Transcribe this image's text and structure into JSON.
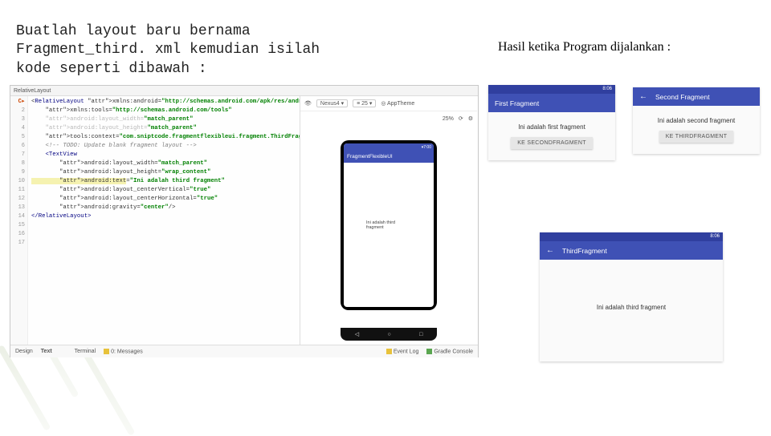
{
  "instruction": "Buatlah layout baru bernama\nFragment_third. xml kemudian isilah\nkode seperti dibawah :",
  "result_heading": "Hasil ketika Program dijalankan :",
  "ide": {
    "tab": "RelativeLayout",
    "toolbar_items": [
      "Nexus4 ▾",
      "≡ 25 ▾",
      "◎ AppTheme"
    ],
    "zoom": "25%",
    "status_time": "▾7:00",
    "appbar_title": "FragmentFlexibleUI",
    "center_text": "Ini adalah third fragment",
    "nav": [
      "◁",
      "○",
      "□"
    ],
    "line_numbers": [
      "1",
      "2",
      "3",
      "4",
      "5",
      "6",
      "7",
      "8",
      "9",
      "10",
      "11",
      "12",
      "13",
      "14",
      "15",
      "16",
      "17",
      ""
    ],
    "code_lines": [
      {
        "t": "<RelativeLayout xmlns:android=\"http://schemas.android.com/apk/res/android\"",
        "cls": ""
      },
      {
        "t": "    xmlns:tools=\"http://schemas.android.com/tools\"",
        "cls": ""
      },
      {
        "t": "    android:layout_width=\"match_parent\"",
        "cls": "dim"
      },
      {
        "t": "    android:layout_height=\"match_parent\"",
        "cls": "dim"
      },
      {
        "t": "    tools:context=\"com.sniptcode.fragmentflexibleui.fragment.ThirdFragment\">",
        "cls": ""
      },
      {
        "t": "",
        "cls": ""
      },
      {
        "t": "    <!-- TODO: Update blank fragment layout -->",
        "cls": "cmt"
      },
      {
        "t": "    <TextView",
        "cls": "tag"
      },
      {
        "t": "        android:layout_width=\"match_parent\"",
        "cls": ""
      },
      {
        "t": "        android:layout_height=\"wrap_content\"",
        "cls": ""
      },
      {
        "t": "        android:text=\"Ini adalah third fragment\"",
        "cls": "hl"
      },
      {
        "t": "        android:layout_centerVertical=\"true\"",
        "cls": ""
      },
      {
        "t": "        android:layout_centerHorizontal=\"true\"",
        "cls": ""
      },
      {
        "t": "        android:gravity=\"center\"/>",
        "cls": ""
      },
      {
        "t": "",
        "cls": ""
      },
      {
        "t": "</RelativeLayout>",
        "cls": "tag"
      }
    ],
    "bottom_left_tabs": [
      "Design",
      "Text"
    ],
    "bottom_tools": [
      "Terminal",
      "0: Messages"
    ],
    "bottom_right_tools": [
      "Event Log",
      "Gradle Console"
    ]
  },
  "shots": {
    "first": {
      "status": "8:06",
      "title": "First Fragment",
      "body": "Ini adalah first fragment",
      "button": "KE SECONDFRAGMENT"
    },
    "second": {
      "status": "",
      "title": "Second Fragment",
      "body": "Ini adalah second fragment",
      "button": "KE THIRDFRAGMENT"
    },
    "third": {
      "status": "8:06",
      "title": "ThirdFragment",
      "body": "Ini adalah third fragment"
    }
  }
}
